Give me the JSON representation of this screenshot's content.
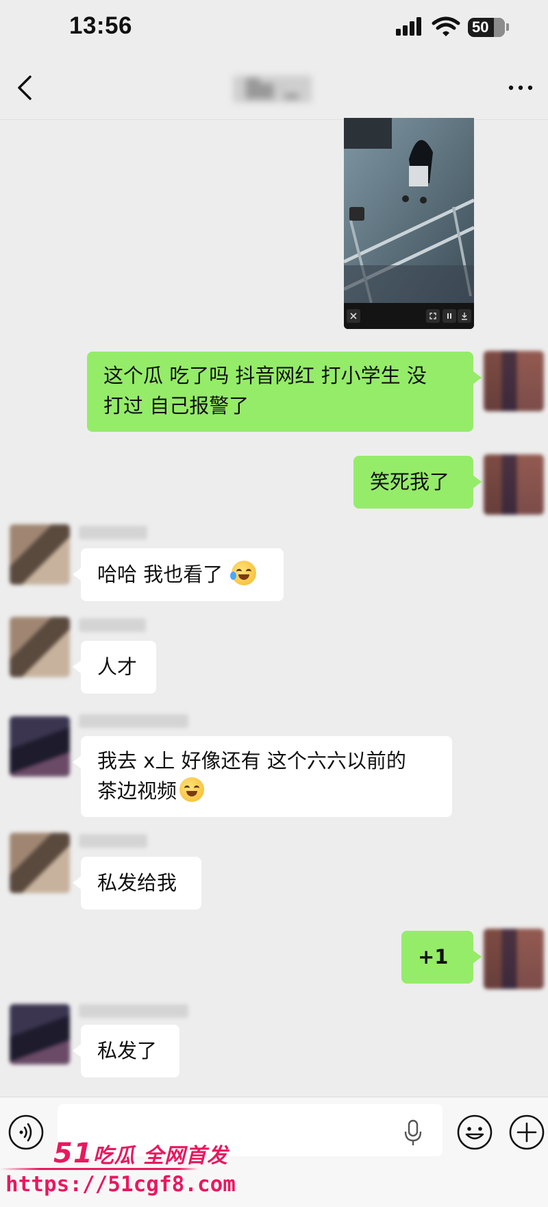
{
  "status_bar": {
    "time": "13:56",
    "battery": "50"
  },
  "nav": {
    "title": "█▆ ·▂"
  },
  "messages": [
    {
      "side": "right",
      "type": "text",
      "text_lines": [
        "这个瓜 吃了吗 抖音网红 打小学生 没",
        "打过 自己报警了"
      ]
    },
    {
      "side": "right",
      "type": "text",
      "text": "笑死我了"
    },
    {
      "side": "left",
      "type": "text",
      "text": "哈哈 我也看了"
    },
    {
      "side": "left",
      "type": "text",
      "text": "人才"
    },
    {
      "side": "left",
      "type": "text",
      "text_lines": [
        "我去 x上 好像还有 这个六六以前的",
        "茶边视频"
      ]
    },
    {
      "side": "left",
      "type": "text",
      "text": "私发给我"
    },
    {
      "side": "right",
      "type": "text",
      "text": "+1"
    },
    {
      "side": "left",
      "type": "text",
      "text": "私发了"
    }
  ],
  "input": {
    "placeholder": ""
  },
  "icons": {
    "back": "chevron-left-icon",
    "more": "more-dots-icon",
    "voice": "voice-icon",
    "mic": "microphone-icon",
    "emoji": "emoji-icon",
    "plus": "plus-circle-icon"
  },
  "watermark": {
    "brand_number": "51",
    "brand_text": "吃瓜 全网首发",
    "url": "https://51cgf8.com"
  },
  "colors": {
    "background": "#ededed",
    "sent_bubble": "#95ec69",
    "received_bubble": "#ffffff",
    "watermark": "#e8195d"
  }
}
